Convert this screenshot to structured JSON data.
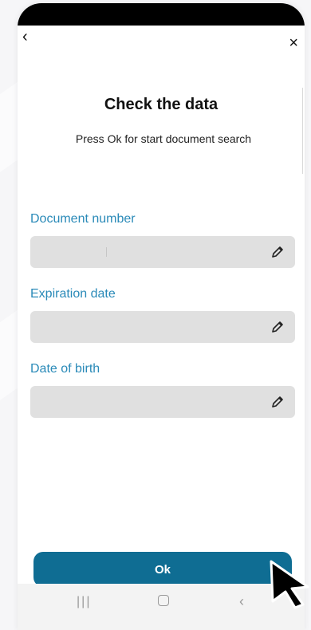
{
  "header": {
    "back_icon": "‹",
    "close_icon": "×"
  },
  "title": "Check the data",
  "subtitle": "Press Ok for start document search",
  "fields": [
    {
      "label": "Document number",
      "value": ""
    },
    {
      "label": "Expiration date",
      "value": ""
    },
    {
      "label": "Date of birth",
      "value": ""
    }
  ],
  "ok_button": {
    "label": "Ok"
  },
  "navbar": {
    "recents": "|||",
    "back": "‹"
  },
  "colors": {
    "accent": "#0f6d93",
    "label": "#2a8ab8",
    "field_bg": "#e0e0e0"
  }
}
